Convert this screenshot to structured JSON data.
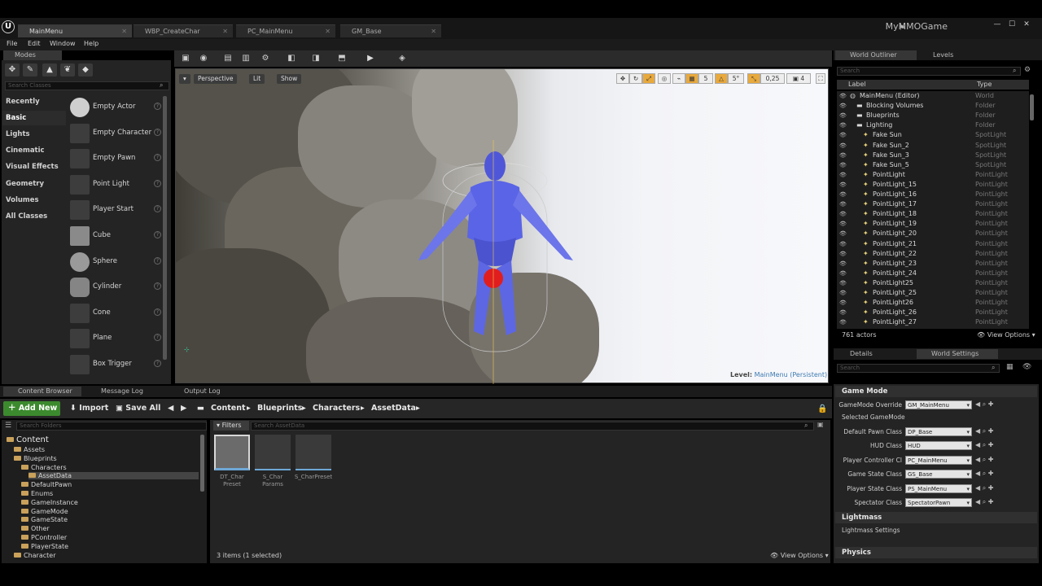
{
  "window": {
    "tabs": [
      "MainMenu",
      "WBP_CreateChar",
      "PC_MainMenu",
      "GM_Base"
    ],
    "project_name": "MyMMOGame",
    "controls": [
      "—",
      "☐",
      "✕"
    ]
  },
  "menu": [
    "File",
    "Edit",
    "Window",
    "Help"
  ],
  "modes": {
    "tab": "Modes",
    "search_placeholder": "Search Classes",
    "categories": [
      "Recently Placed",
      "Basic",
      "Lights",
      "Cinematic",
      "Visual Effects",
      "Geometry",
      "Volumes",
      "All Classes"
    ],
    "classes": [
      "Empty Actor",
      "Empty Character",
      "Empty Pawn",
      "Point Light",
      "Player Start",
      "Cube",
      "Sphere",
      "Cylinder",
      "Cone",
      "Plane",
      "Box Trigger"
    ]
  },
  "viewport": {
    "perspective": "Perspective",
    "lit": "Lit",
    "show": "Show",
    "snap_grid": "5",
    "snap_rot": "5°",
    "snap_scale": "0,25",
    "cam_speed": "4",
    "level_prefix": "Level:",
    "level_name": "MainMenu (Persistent)"
  },
  "outliner": {
    "tab": "World Outliner",
    "tab2": "Levels",
    "search_placeholder": "Search",
    "col_label": "Label",
    "col_type": "Type",
    "rows": [
      {
        "name": "MainMenu (Editor)",
        "type": "World",
        "indent": 0
      },
      {
        "name": "Blocking Volumes",
        "type": "Folder",
        "indent": 1
      },
      {
        "name": "Blueprints",
        "type": "Folder",
        "indent": 1
      },
      {
        "name": "Lighting",
        "type": "Folder",
        "indent": 1
      },
      {
        "name": "Fake Sun",
        "type": "SpotLight",
        "indent": 2
      },
      {
        "name": "Fake Sun_2",
        "type": "SpotLight",
        "indent": 2
      },
      {
        "name": "Fake Sun_3",
        "type": "SpotLight",
        "indent": 2
      },
      {
        "name": "Fake Sun_5",
        "type": "SpotLight",
        "indent": 2
      },
      {
        "name": "PointLight",
        "type": "PointLight",
        "indent": 2
      },
      {
        "name": "PointLight_15",
        "type": "PointLight",
        "indent": 2
      },
      {
        "name": "PointLight_16",
        "type": "PointLight",
        "indent": 2
      },
      {
        "name": "PointLight_17",
        "type": "PointLight",
        "indent": 2
      },
      {
        "name": "PointLight_18",
        "type": "PointLight",
        "indent": 2
      },
      {
        "name": "PointLight_19",
        "type": "PointLight",
        "indent": 2
      },
      {
        "name": "PointLight_20",
        "type": "PointLight",
        "indent": 2
      },
      {
        "name": "PointLight_21",
        "type": "PointLight",
        "indent": 2
      },
      {
        "name": "PointLight_22",
        "type": "PointLight",
        "indent": 2
      },
      {
        "name": "PointLight_23",
        "type": "PointLight",
        "indent": 2
      },
      {
        "name": "PointLight_24",
        "type": "PointLight",
        "indent": 2
      },
      {
        "name": "PointLight25",
        "type": "PointLight",
        "indent": 2
      },
      {
        "name": "PointLight_25",
        "type": "PointLight",
        "indent": 2
      },
      {
        "name": "PointLight26",
        "type": "PointLight",
        "indent": 2
      },
      {
        "name": "PointLight_26",
        "type": "PointLight",
        "indent": 2
      },
      {
        "name": "PointLight_27",
        "type": "PointLight",
        "indent": 2
      }
    ],
    "actor_count": "761 actors",
    "view_options": "View Options"
  },
  "details": {
    "tab": "Details",
    "tab2": "World Settings",
    "search_placeholder": "Search",
    "section_game_mode": "Game Mode",
    "subsection_selected": "Selected GameMode",
    "section_lightmass": "Lightmass",
    "subsection_lightmass": "Lightmass Settings",
    "section_physics": "Physics",
    "props": [
      {
        "label": "GameMode Override",
        "value": "GM_MainMenu"
      },
      {
        "label": "Default Pawn Class",
        "value": "DP_Base"
      },
      {
        "label": "HUD Class",
        "value": "HUD"
      },
      {
        "label": "Player Controller Cl",
        "value": "PC_MainMenu"
      },
      {
        "label": "Game State Class",
        "value": "GS_Base"
      },
      {
        "label": "Player State Class",
        "value": "PS_MainMenu"
      },
      {
        "label": "Spectator Class",
        "value": "SpectatorPawn"
      }
    ]
  },
  "content_browser": {
    "tabs": [
      "Content Browser",
      "Message Log",
      "Output Log"
    ],
    "add_new": "Add New",
    "import": "Import",
    "save_all": "Save All",
    "path": [
      "Content",
      "Blueprints",
      "Characters",
      "AssetData"
    ],
    "search_folders": "Search Folders",
    "filters": "Filters",
    "search_assets": "Search AssetData",
    "tree": [
      {
        "name": "Content",
        "level": 0
      },
      {
        "name": "Assets",
        "level": 1
      },
      {
        "name": "Blueprints",
        "level": 1
      },
      {
        "name": "Characters",
        "level": 2
      },
      {
        "name": "AssetData",
        "level": 3
      },
      {
        "name": "DefaultPawn",
        "level": 2
      },
      {
        "name": "Enums",
        "level": 2
      },
      {
        "name": "GameInstance",
        "level": 2
      },
      {
        "name": "GameMode",
        "level": 2
      },
      {
        "name": "GameState",
        "level": 2
      },
      {
        "name": "Other",
        "level": 2
      },
      {
        "name": "PController",
        "level": 2
      },
      {
        "name": "PlayerState",
        "level": 2
      },
      {
        "name": "Character",
        "level": 1
      }
    ],
    "assets": [
      {
        "name": "DT_Char Preset",
        "selected": true
      },
      {
        "name": "S_Char Params",
        "selected": false
      },
      {
        "name": "S_CharPreset",
        "selected": false
      }
    ],
    "status": "3 items (1 selected)",
    "view_options": "View Options"
  }
}
